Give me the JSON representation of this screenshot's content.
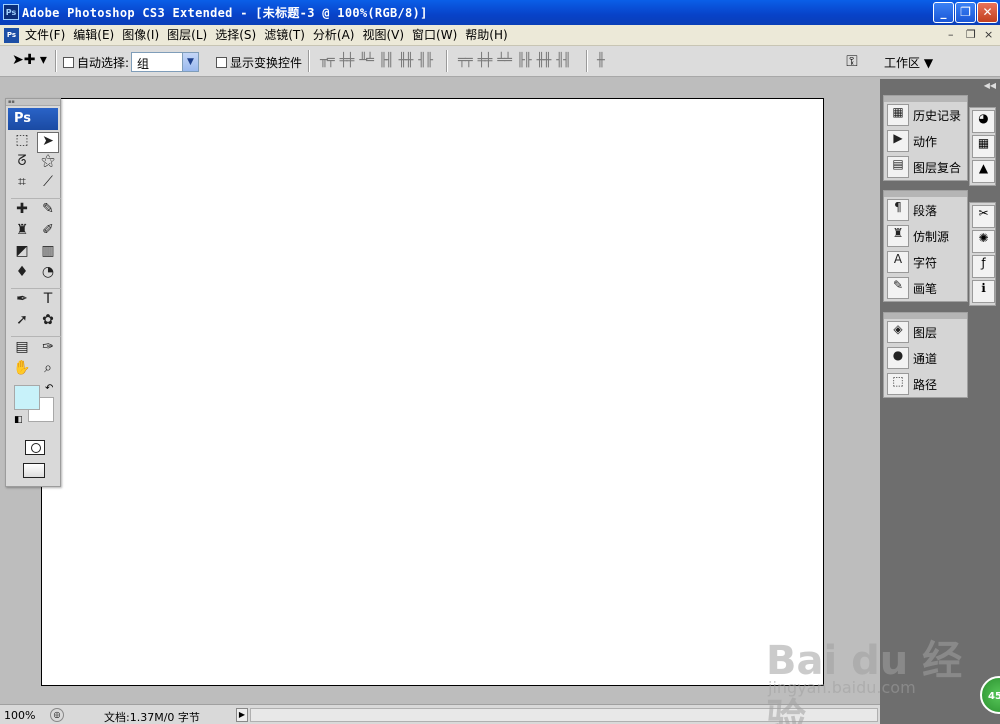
{
  "window": {
    "app_icon_text": "Ps",
    "title": "Adobe Photoshop CS3 Extended - [未标题-3 @ 100%(RGB/8)]",
    "buttons": {
      "minimize": "_",
      "restore": "❐",
      "close": "✕"
    }
  },
  "menubar": {
    "items": [
      {
        "label": "文件(F)"
      },
      {
        "label": "编辑(E)"
      },
      {
        "label": "图像(I)"
      },
      {
        "label": "图层(L)"
      },
      {
        "label": "选择(S)"
      },
      {
        "label": "滤镜(T)"
      },
      {
        "label": "分析(A)"
      },
      {
        "label": "视图(V)"
      },
      {
        "label": "窗口(W)"
      },
      {
        "label": "帮助(H)"
      }
    ],
    "doc_controls": {
      "minimize": "–",
      "restore": "❐",
      "close": "×"
    }
  },
  "options": {
    "auto_select_label": "自动选择:",
    "auto_select_value": "组",
    "show_transform_label": "显示变换控件",
    "workspace_label": "工作区 ▼"
  },
  "panels": {
    "group1": [
      "历史记录",
      "动作",
      "图层复合"
    ],
    "group2": [
      "段落",
      "仿制源",
      "字符",
      "画笔"
    ],
    "group3": [
      "图层",
      "通道",
      "路径"
    ]
  },
  "status": {
    "zoom": "100%",
    "doc_info": "文档:1.37M/0 字节"
  },
  "colors": {
    "foreground": "#c8f2fa",
    "background": "#ffffff",
    "titlebar": "#0842c8"
  },
  "watermark": {
    "logo": "Bai du 经验",
    "url": "jingyan.baidu.com",
    "badge": "45"
  }
}
